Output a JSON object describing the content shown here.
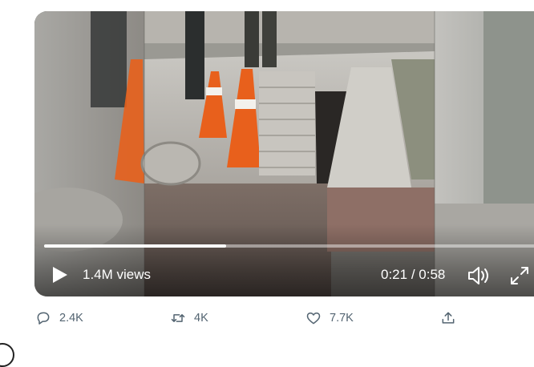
{
  "video": {
    "views": "1.4M views",
    "current_time": "0:21",
    "separator": " / ",
    "duration": "0:58",
    "progress": 0.37
  },
  "actions": {
    "reply_count": "2.4K",
    "retweet_count": "4K",
    "like_count": "7.7K"
  },
  "icons": {
    "play": "play-icon",
    "volume": "volume-icon",
    "fullscreen": "fullscreen-icon",
    "reply": "reply-icon",
    "retweet": "retweet-icon",
    "like": "heart-icon",
    "share": "share-icon"
  },
  "colors": {
    "action_gray": "#536471",
    "cone_orange": "#e8601c",
    "progress_white": "#ffffff"
  }
}
